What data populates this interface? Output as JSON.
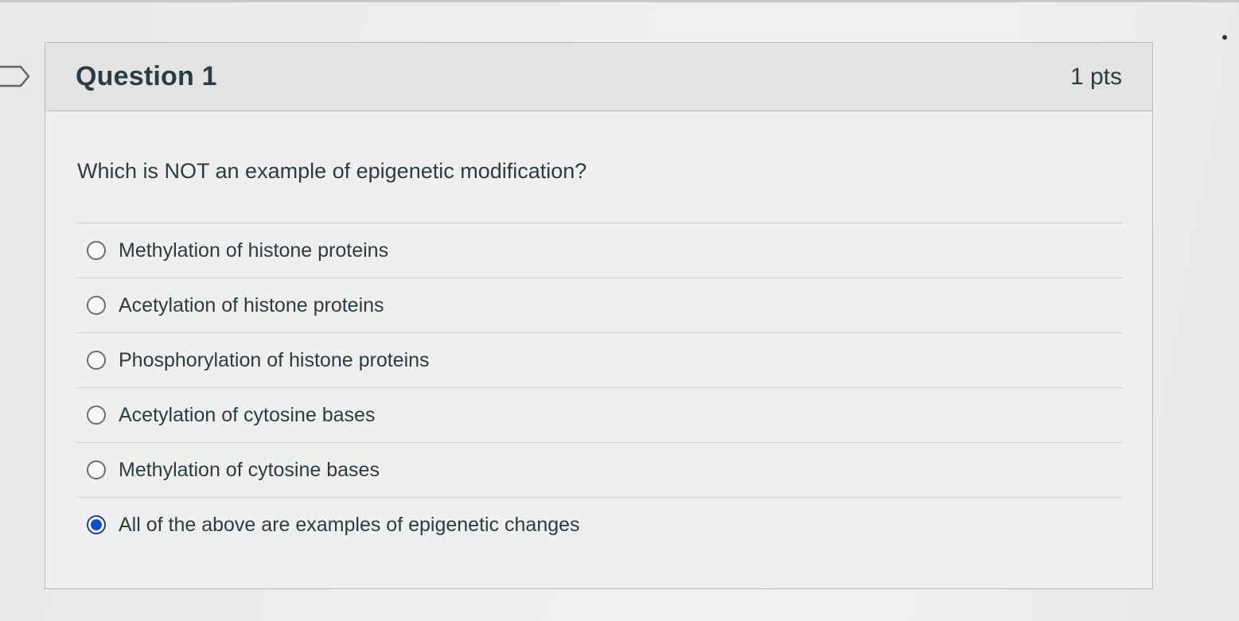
{
  "question": {
    "title": "Question 1",
    "points": "1 pts",
    "text": "Which is NOT an example of epigenetic modification?",
    "answers": [
      {
        "label": "Methylation of histone proteins",
        "selected": false
      },
      {
        "label": "Acetylation of histone proteins",
        "selected": false
      },
      {
        "label": "Phosphorylation of histone proteins",
        "selected": false
      },
      {
        "label": "Acetylation of cytosine bases",
        "selected": false
      },
      {
        "label": "Methylation of cytosine bases",
        "selected": false
      },
      {
        "label": "All of the above are examples of epigenetic changes",
        "selected": true
      }
    ]
  },
  "colors": {
    "text": "#2d3b45",
    "selected_radio": "#0b4fd6",
    "header_bg": "#e3e3e2"
  },
  "icons": {
    "bookmark": "bookmark-flag-icon"
  }
}
